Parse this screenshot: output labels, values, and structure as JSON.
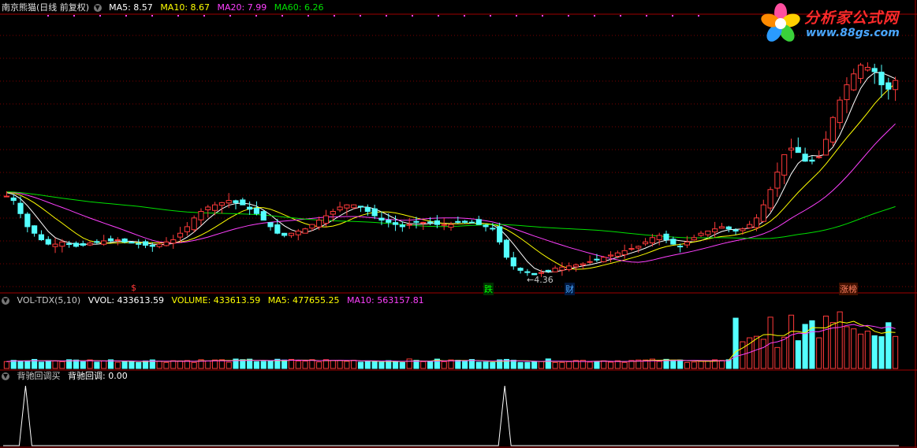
{
  "main_header": {
    "title": "南京熊猫(日线 前复权)",
    "ma5": "MA5: 8.57",
    "ma10": "MA10: 8.67",
    "ma20": "MA20: 7.99",
    "ma60": "MA60: 6.26"
  },
  "vol_header": {
    "name": "VOL-TDX(5,10)",
    "vvol": "VVOL: 433613.59",
    "volume": "VOLUME: 433613.59",
    "ma5": "MA5: 477655.25",
    "ma10": "MA10: 563157.81"
  },
  "ind_header": {
    "name": "背驰回调买",
    "value": "背驰回调: 0.00"
  },
  "logo": {
    "brand": "分析家公式网",
    "url": "www.88gs.com"
  },
  "markers": {
    "dollar": "$",
    "die": "跌",
    "cai": "财",
    "zhangbang": "涨榜",
    "low_price": "4.36"
  },
  "colors": {
    "up": "#ff3a3a",
    "down": "#54ffff",
    "ma5": "#ffffff",
    "ma10": "#ffff00",
    "ma20": "#ff40ff",
    "ma60": "#00e000",
    "grid": "#7a0000"
  },
  "chart_data": [
    {
      "type": "candlestick",
      "ma_lines": [
        "MA5",
        "MA10",
        "MA20",
        "MA60"
      ],
      "note_price": 4.36,
      "closes": [
        8.0,
        7.8,
        7.2,
        6.6,
        6.3,
        6.0,
        5.8,
        5.8,
        5.9,
        5.8,
        5.7,
        5.75,
        5.85,
        5.9,
        5.95,
        5.95,
        6.0,
        5.9,
        5.85,
        5.8,
        5.75,
        5.7,
        5.8,
        5.9,
        6.0,
        6.3,
        6.6,
        7.0,
        7.3,
        7.5,
        7.6,
        7.7,
        7.8,
        7.7,
        7.6,
        7.4,
        7.2,
        6.9,
        6.6,
        6.3,
        6.2,
        6.3,
        6.4,
        6.5,
        6.7,
        6.9,
        7.1,
        7.3,
        7.5,
        7.6,
        7.6,
        7.5,
        7.3,
        7.1,
        6.9,
        6.8,
        6.7,
        6.6,
        6.7,
        6.8,
        6.8,
        6.8,
        6.7,
        6.7,
        6.7,
        6.8,
        6.8,
        6.8,
        6.7,
        6.6,
        6.5,
        5.9,
        5.2,
        4.8,
        4.6,
        4.5,
        4.4,
        4.5,
        4.6,
        4.7,
        4.75,
        4.8,
        4.85,
        4.9,
        5.0,
        5.1,
        5.2,
        5.3,
        5.4,
        5.5,
        5.6,
        5.7,
        5.9,
        6.1,
        6.2,
        6.0,
        5.8,
        5.7,
        5.9,
        6.1,
        6.3,
        6.4,
        6.5,
        6.6,
        6.5,
        6.4,
        6.5,
        6.7,
        7.0,
        7.6,
        8.3,
        9.1,
        9.9,
        10.2,
        10.0,
        9.6,
        9.6,
        9.8,
        10.6,
        11.6,
        12.4,
        13.1,
        13.6,
        14.0,
        13.9,
        13.7,
        13.1,
        12.9,
        13.3
      ]
    },
    {
      "type": "bar",
      "name": "VOL-TDX(5,10)",
      "values": [
        433613.59
      ],
      "ma5": 477655.25,
      "ma10": 563157.81
    },
    {
      "type": "line",
      "name": "背驰回调买",
      "value": 0.0,
      "spikes_at": [
        0.025,
        0.56
      ]
    }
  ]
}
